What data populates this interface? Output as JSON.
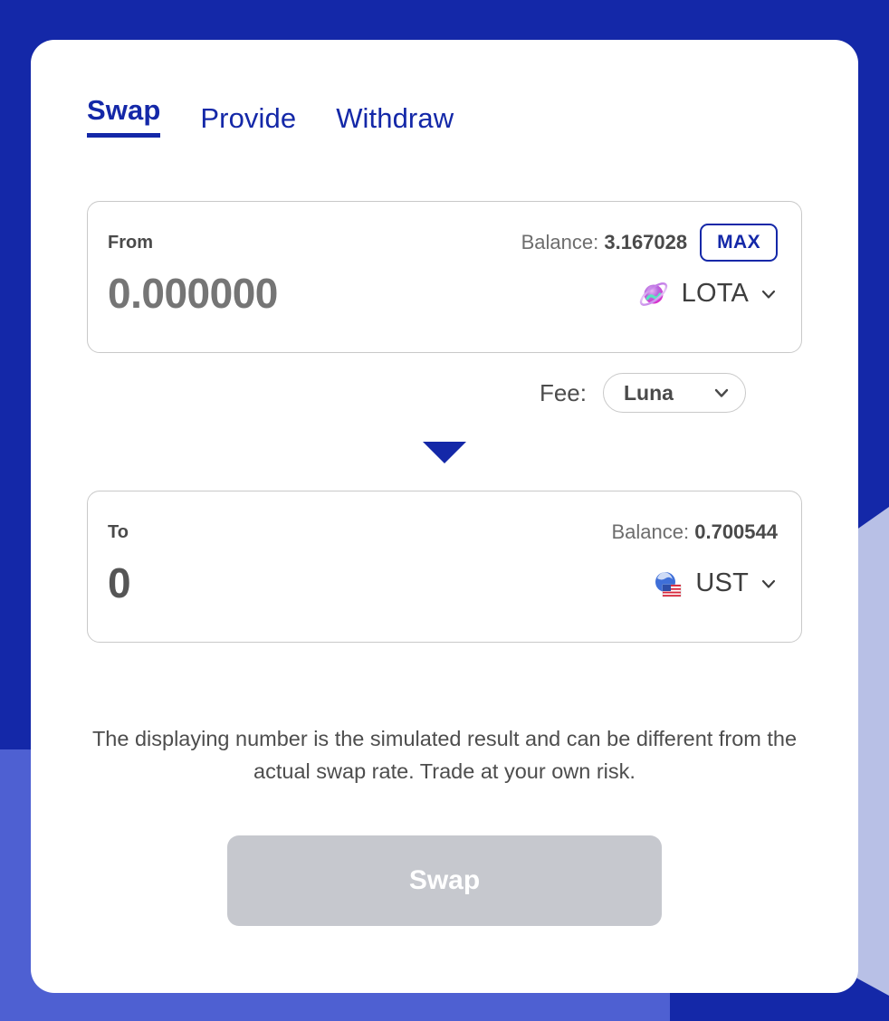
{
  "theme": {
    "background_blue": "#1428a8",
    "accent_blue": "#1428a8",
    "shape_periwinkle": "#b8c0e6",
    "shape_indigo": "#4e60d2",
    "disabled_gray": "#c6c8ce"
  },
  "tabs": [
    {
      "label": "Swap",
      "active": true
    },
    {
      "label": "Provide",
      "active": false
    },
    {
      "label": "Withdraw",
      "active": false
    }
  ],
  "from": {
    "label": "From",
    "balance_label": "Balance:",
    "balance_value": "3.167028",
    "max_label": "MAX",
    "amount_placeholder": "0.000000",
    "amount_value": "",
    "token": "LOTA",
    "token_icon": "planet-icon",
    "chevron_icon": "chevron-down-icon"
  },
  "fee": {
    "label": "Fee:",
    "selected": "Luna",
    "chevron_icon": "chevron-down-icon"
  },
  "direction": {
    "icon": "triangle-down-icon"
  },
  "to": {
    "label": "To",
    "balance_label": "Balance:",
    "balance_value": "0.700544",
    "amount_value": "0",
    "token": "UST",
    "token_icon": "globe-flag-icon",
    "chevron_icon": "chevron-down-icon"
  },
  "disclaimer": "The displaying number is the simulated result and can be different from the actual swap rate. Trade at your own risk.",
  "action": {
    "swap_label": "Swap",
    "disabled": true
  }
}
